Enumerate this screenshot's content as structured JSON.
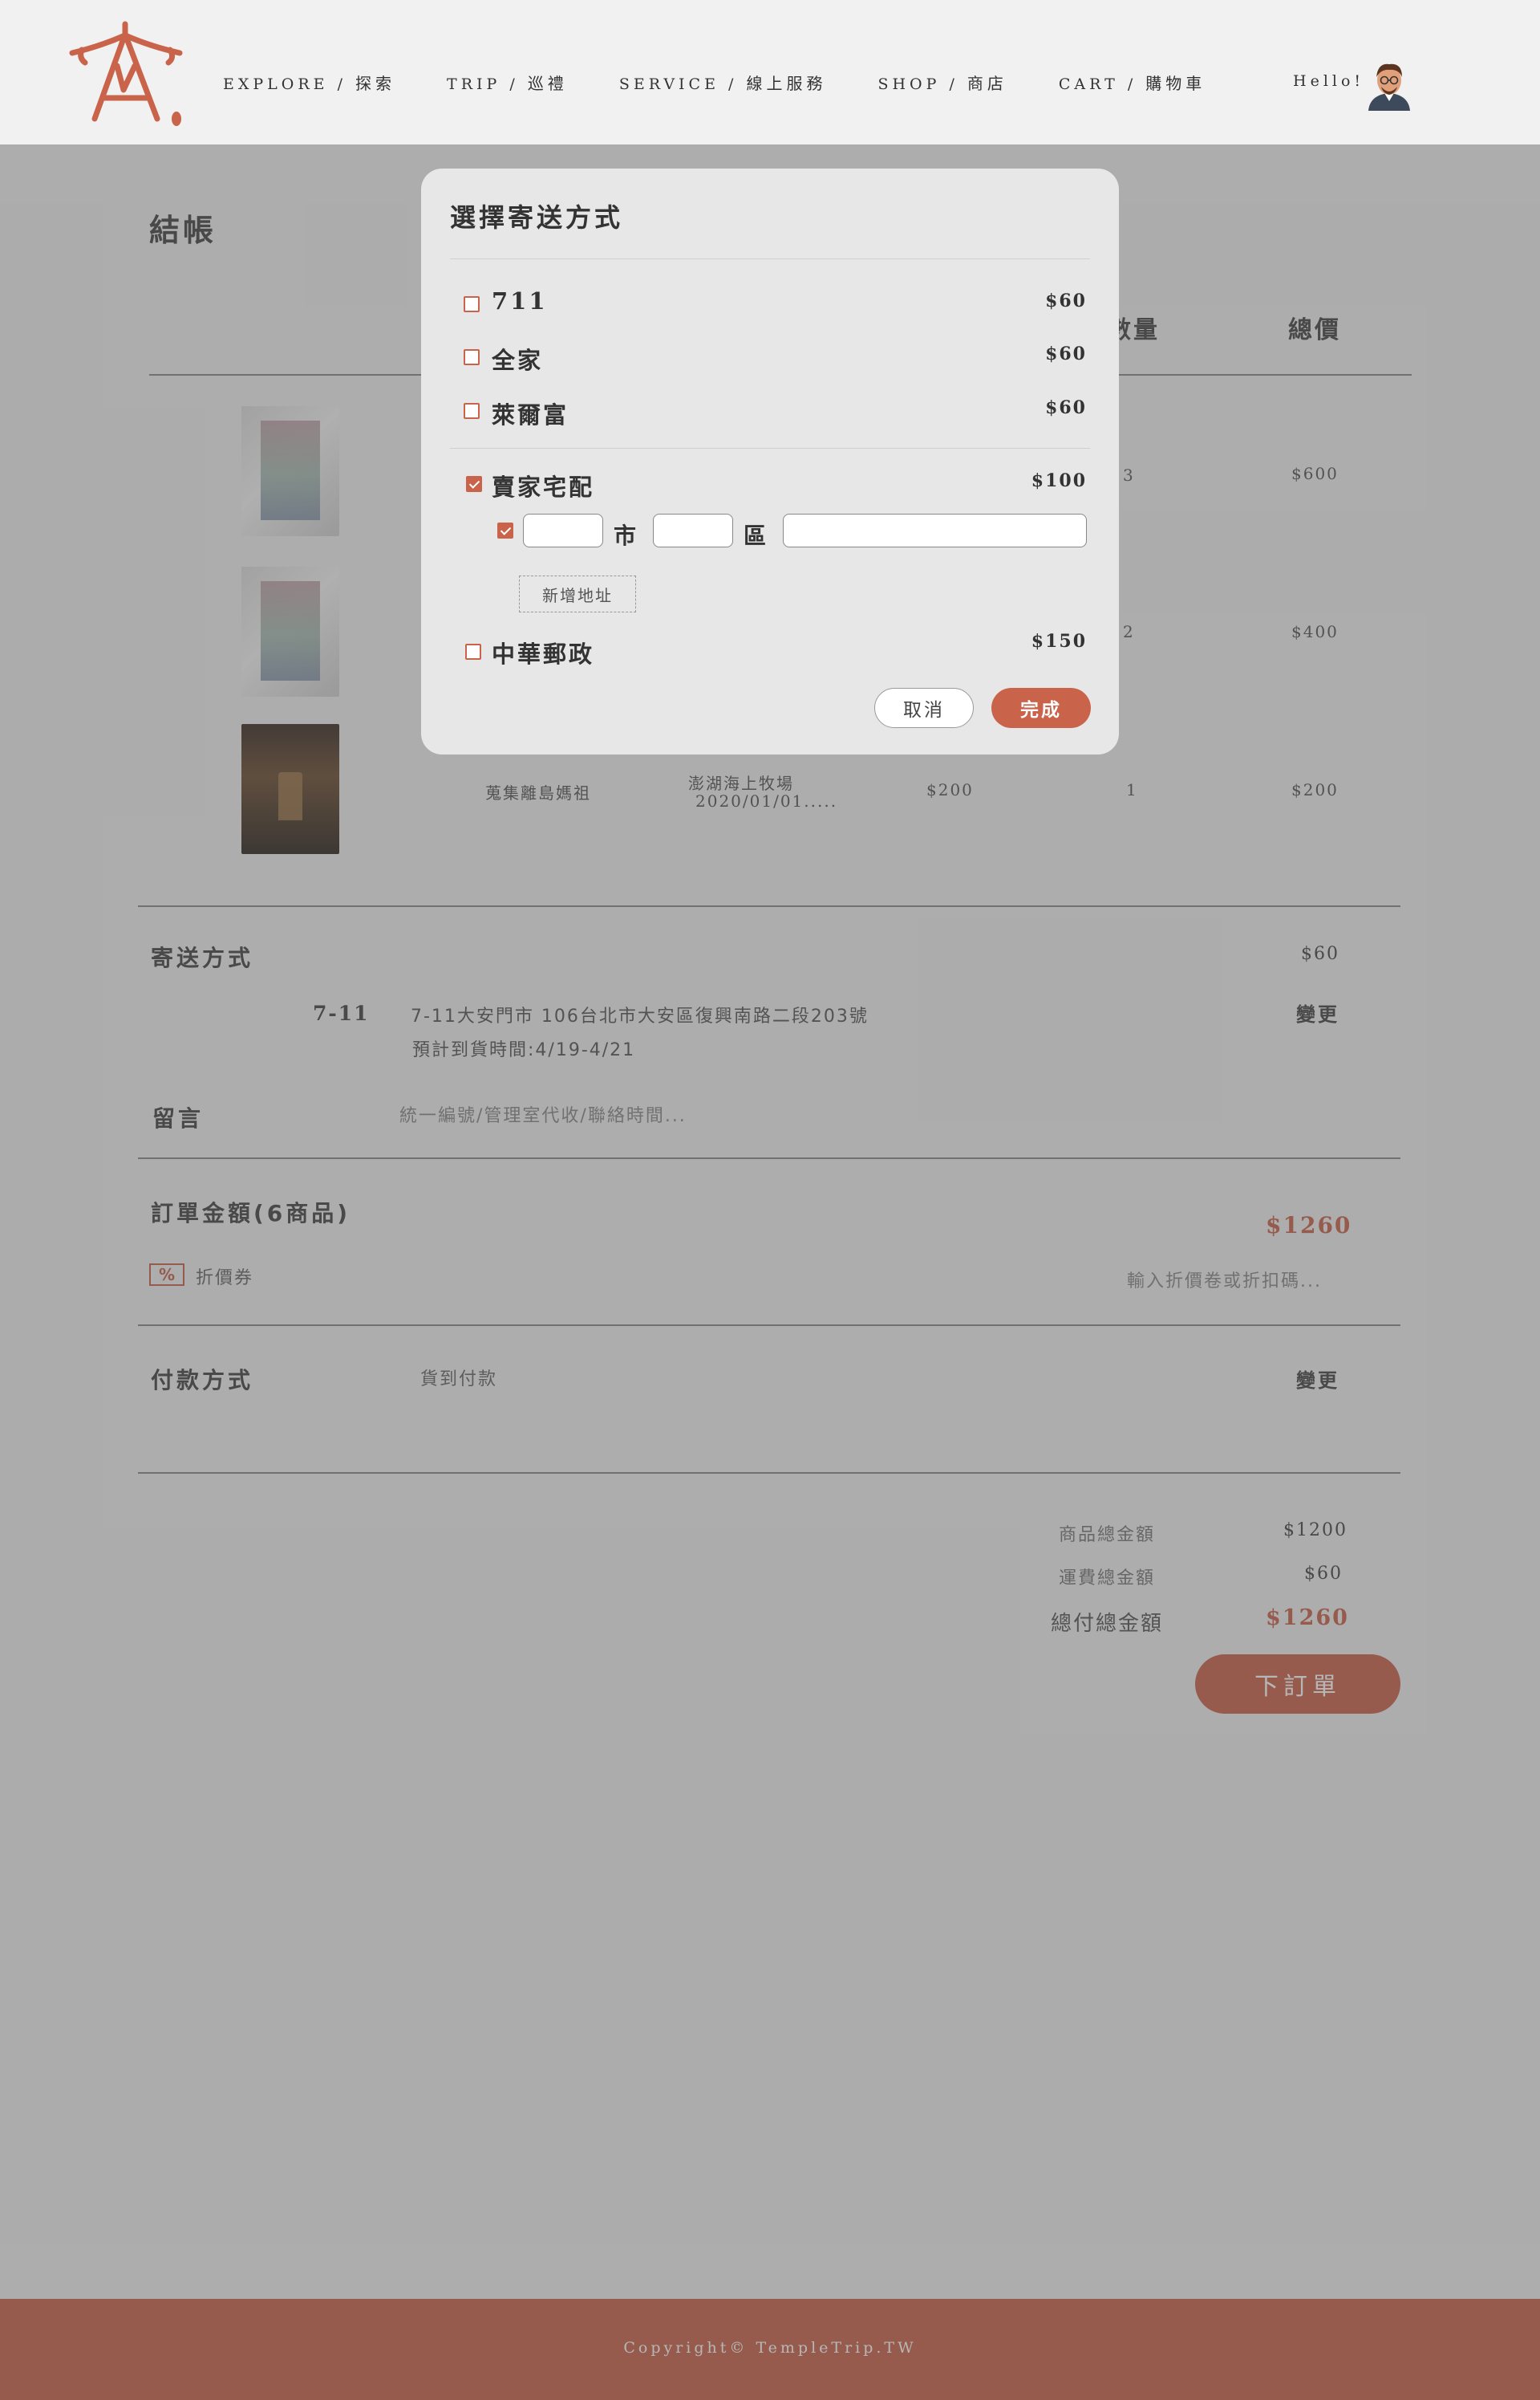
{
  "nav": {
    "items": [
      {
        "en": "EXPLORE",
        "zh": "探索"
      },
      {
        "en": "TRIP",
        "zh": "巡禮"
      },
      {
        "en": "SERVICE",
        "zh": "線上服務"
      },
      {
        "en": "SHOP",
        "zh": "商店"
      },
      {
        "en": "CART",
        "zh": "購物車"
      }
    ],
    "separator": " / ",
    "hello": "Hello!"
  },
  "page": {
    "title": "結帳",
    "columns": {
      "qty": "數量",
      "total": "總價"
    }
  },
  "products": [
    {
      "qty": "3",
      "total": "$600"
    },
    {
      "qty": "2",
      "total": "$400"
    },
    {
      "name": "蒐集離島媽祖",
      "spec_line1": "澎湖海上牧場",
      "spec_line2": "2020/01/01.....",
      "price": "$200",
      "qty": "1",
      "total": "$200"
    }
  ],
  "shipping": {
    "title": "寄送方式",
    "fee": "$60",
    "method": "7-11",
    "address": "7-11大安門市 106台北市大安區復興南路二段203號",
    "eta": "預計到貨時間:4/19-4/21",
    "change": "變更"
  },
  "note": {
    "title": "留言",
    "placeholder": "統一編號/管理室代收/聯絡時間..."
  },
  "order_amount": {
    "title": "訂單金額(6商品)",
    "amount": "$1260",
    "coupon_icon": "%",
    "coupon_label": "折價券",
    "coupon_placeholder": "輸入折價卷或折扣碼..."
  },
  "payment": {
    "title": "付款方式",
    "method": "貨到付款",
    "change": "變更"
  },
  "summary": {
    "goods_label": "商品總金額",
    "goods": "$1200",
    "shipping_label": "運費總金額",
    "shipping": "$60",
    "total_label": "總付總金額",
    "total": "$1260"
  },
  "order_button": "下訂單",
  "footer": "Copyright© TempleTrip.TW",
  "modal": {
    "title": "選擇寄送方式",
    "options": [
      {
        "label": "711",
        "price": "$60",
        "checked": false
      },
      {
        "label": "全家",
        "price": "$60",
        "checked": false
      },
      {
        "label": "萊爾富",
        "price": "$60",
        "checked": false
      },
      {
        "label": "賣家宅配",
        "price": "$100",
        "checked": true
      },
      {
        "label": "中華郵政",
        "price": "$150",
        "checked": false
      }
    ],
    "address": {
      "city_unit": "市",
      "district_unit": "區",
      "checked": true
    },
    "add_address": "新增地址",
    "cancel": "取消",
    "done": "完成"
  },
  "colors": {
    "accent": "#c9634a",
    "background": "#efefef",
    "overlay": "rgba(80,80,80,0.42)"
  }
}
